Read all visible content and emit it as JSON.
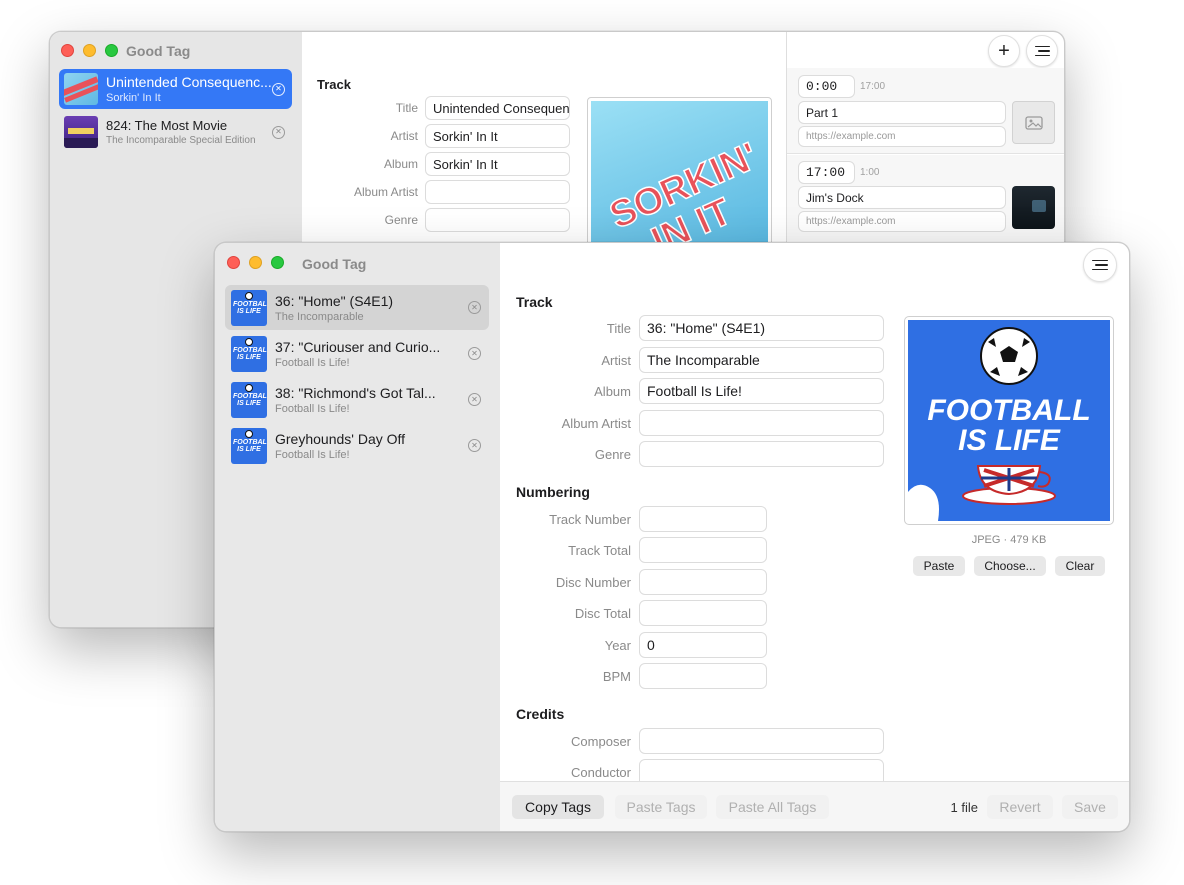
{
  "back_window": {
    "title": "Good Tag",
    "sidebar": [
      {
        "title": "Unintended Consequenc...",
        "subtitle": "Sorkin' In It"
      },
      {
        "title": "824: The Most Movie",
        "subtitle": "The Incomparable Special Edition"
      }
    ],
    "track_section": "Track",
    "fields": [
      {
        "label": "Title",
        "value": "Unintended Consequen"
      },
      {
        "label": "Artist",
        "value": "Sorkin' In It"
      },
      {
        "label": "Album",
        "value": "Sorkin' In It"
      },
      {
        "label": "Album Artist",
        "value": ""
      },
      {
        "label": "Genre",
        "value": ""
      }
    ],
    "artwork_text": [
      "SORKIN'",
      "IN IT"
    ],
    "chapters": [
      {
        "time": "0:00",
        "duration": "17:00",
        "title": "Part 1",
        "url_placeholder": "https://example.com"
      },
      {
        "time": "17:00",
        "duration": "1:00",
        "title": "Jim's Dock",
        "url_placeholder": "https://example.com"
      }
    ],
    "icons": {
      "add": "plus-icon",
      "list": "list-icon",
      "image_placeholder": "photo-icon"
    }
  },
  "front_window": {
    "title": "Good Tag",
    "sidebar": [
      {
        "title": "36: \"Home\" (S4E1)",
        "subtitle": "The Incomparable",
        "selected": true
      },
      {
        "title": "37: \"Curiouser and Curio...",
        "subtitle": "Football Is Life!",
        "selected": false
      },
      {
        "title": "38: \"Richmond's Got Tal...",
        "subtitle": "Football Is Life!",
        "selected": false
      },
      {
        "title": "Greyhounds' Day Off",
        "subtitle": "Football Is Life!",
        "selected": false
      }
    ],
    "sections": {
      "track": "Track",
      "numbering": "Numbering",
      "credits": "Credits"
    },
    "track_fields": [
      {
        "label": "Title",
        "value": "36: \"Home\" (S4E1)"
      },
      {
        "label": "Artist",
        "value": "The Incomparable"
      },
      {
        "label": "Album",
        "value": "Football Is Life!"
      },
      {
        "label": "Album Artist",
        "value": ""
      },
      {
        "label": "Genre",
        "value": ""
      }
    ],
    "numbering_fields": [
      {
        "label": "Track Number",
        "value": ""
      },
      {
        "label": "Track Total",
        "value": ""
      },
      {
        "label": "Disc Number",
        "value": ""
      },
      {
        "label": "Disc Total",
        "value": ""
      },
      {
        "label": "Year",
        "value": "0"
      },
      {
        "label": "BPM",
        "value": ""
      }
    ],
    "credits_fields": [
      {
        "label": "Composer",
        "value": ""
      },
      {
        "label": "Conductor",
        "value": ""
      }
    ],
    "artwork": {
      "lines": [
        "FOOTBALL",
        "IS LIFE"
      ],
      "info": "JPEG · 479 KB",
      "paste": "Paste",
      "choose": "Choose...",
      "clear": "Clear"
    },
    "footer": {
      "copy": "Copy Tags",
      "paste": "Paste Tags",
      "paste_all": "Paste All Tags",
      "count": "1 file",
      "revert": "Revert",
      "save": "Save"
    },
    "colors": {
      "selection": "#3478f6",
      "artwork_bg": "#2f6fe3"
    }
  }
}
